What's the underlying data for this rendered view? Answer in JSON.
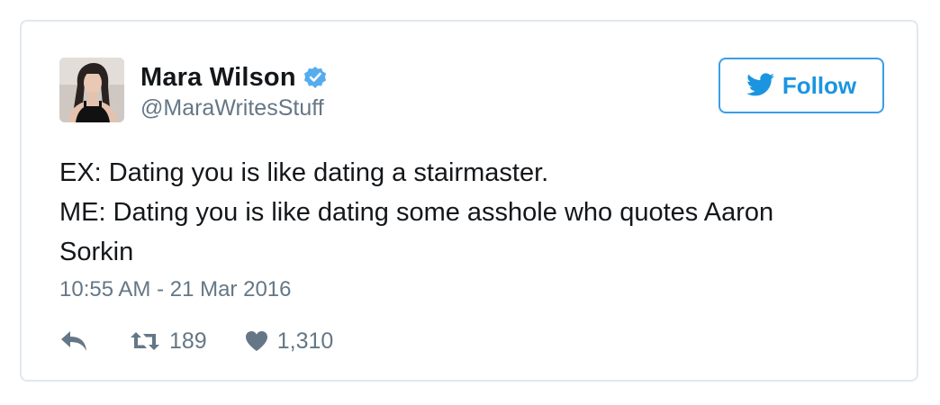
{
  "tweet": {
    "author": {
      "display_name": "Mara Wilson",
      "handle": "@MaraWritesStuff",
      "verified": true,
      "avatar_icon": "avatar-photo"
    },
    "follow_button": {
      "label": "Follow",
      "icon": "twitter-bird-icon"
    },
    "text_lines": [
      "EX: Dating you is like dating a stairmaster.",
      "ME: Dating you is like dating some asshole who quotes Aaron",
      "Sorkin"
    ],
    "timestamp": "10:55 AM - 21 Mar 2016",
    "actions": {
      "reply_icon": "reply-icon",
      "retweet_icon": "retweet-icon",
      "retweet_count": "189",
      "like_icon": "heart-icon",
      "like_count": "1,310"
    }
  },
  "colors": {
    "accent": "#1b95e0",
    "verified": "#55acee",
    "text_primary": "#14171a",
    "text_secondary": "#657786",
    "card_border": "#e1e8ed"
  }
}
